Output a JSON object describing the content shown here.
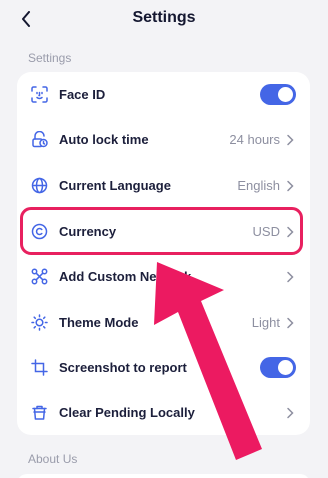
{
  "header": {
    "title": "Settings"
  },
  "sections": {
    "settings_label": "Settings",
    "about_label": "About Us"
  },
  "settings_items": [
    {
      "label": "Face ID",
      "icon": "face-id-icon",
      "toggle": true
    },
    {
      "label": "Auto lock time",
      "icon": "clock-lock-icon",
      "value": "24 hours"
    },
    {
      "label": "Current Language",
      "icon": "globe-icon",
      "value": "English"
    },
    {
      "label": "Currency",
      "icon": "currency-icon",
      "value": "USD"
    },
    {
      "label": "Add Custom Network",
      "icon": "network-icon"
    },
    {
      "label": "Theme Mode",
      "icon": "sun-icon",
      "value": "Light"
    },
    {
      "label": "Screenshot to report",
      "icon": "crop-icon",
      "toggle": true
    },
    {
      "label": "Clear Pending Locally",
      "icon": "trash-icon"
    }
  ],
  "colors": {
    "accent": "#4466e6",
    "highlight": "#e8205f",
    "background": "#f3f3f6"
  }
}
